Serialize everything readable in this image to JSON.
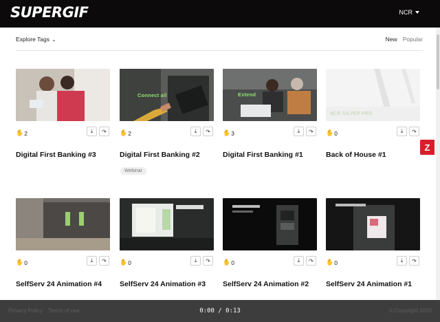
{
  "header": {
    "logo": "SUPERGIF",
    "account": "NCR"
  },
  "filters": {
    "explore": "Explore Tags",
    "sort_new": "New",
    "sort_popular": "Popular"
  },
  "cards": [
    {
      "title": "Digital First Banking #3",
      "likes": "2",
      "thumb_text": ""
    },
    {
      "title": "Digital First Banking #2",
      "likes": "2",
      "thumb_text": "Connect all",
      "tag": "Webinar"
    },
    {
      "title": "Digital First Banking #1",
      "likes": "3",
      "thumb_text": "Extend"
    },
    {
      "title": "Back of House #1",
      "likes": "0",
      "thumb_text": "NCR SILVER PRO"
    },
    {
      "title": "SelfServ 24 Animation #4",
      "likes": "0",
      "thumb_text": ""
    },
    {
      "title": "SelfServ 24 Animation #3",
      "likes": "0",
      "thumb_text": ""
    },
    {
      "title": "SelfServ 24 Animation #2",
      "likes": "0",
      "thumb_text": ""
    },
    {
      "title": "SelfServ 24 Animation #1",
      "likes": "0",
      "thumb_text": ""
    }
  ],
  "side_badge": "Z",
  "footer": {
    "privacy": "Privacy Policy",
    "terms": "Terms of use",
    "copyright": "© Copyright 2020",
    "timer": "0:00 / 0:13"
  },
  "icons": {
    "like": "hand-icon",
    "download": "download-icon",
    "share": "share-icon"
  }
}
